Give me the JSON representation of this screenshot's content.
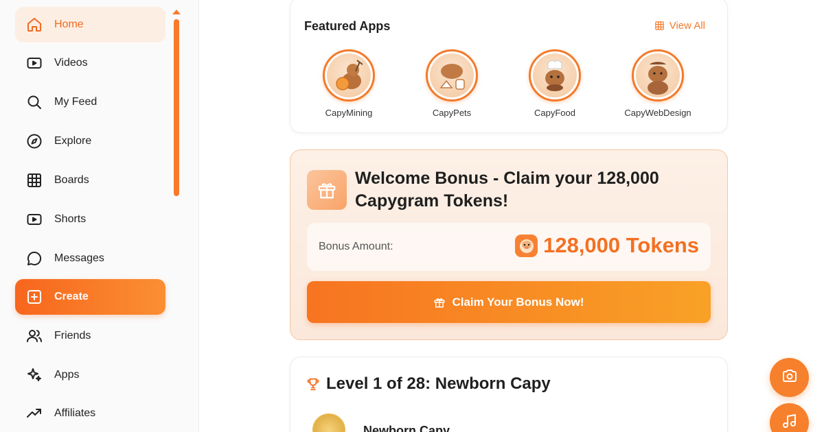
{
  "sidebar": {
    "items": [
      {
        "label": "Home",
        "icon": "home-icon"
      },
      {
        "label": "Videos",
        "icon": "video-icon"
      },
      {
        "label": "My Feed",
        "icon": "search-icon"
      },
      {
        "label": "Explore",
        "icon": "compass-icon"
      },
      {
        "label": "Boards",
        "icon": "grid-icon"
      },
      {
        "label": "Shorts",
        "icon": "video-icon"
      },
      {
        "label": "Messages",
        "icon": "chat-bubble-icon"
      },
      {
        "label": "Create",
        "icon": "plus-square-icon"
      },
      {
        "label": "Friends",
        "icon": "users-icon"
      },
      {
        "label": "Apps",
        "icon": "sparkles-icon"
      },
      {
        "label": "Affiliates",
        "icon": "trending-up-icon"
      }
    ],
    "active": "Home",
    "highlighted": "Create"
  },
  "featured": {
    "title": "Featured Apps",
    "view_all": "View All",
    "apps": [
      {
        "name": "CapyMining"
      },
      {
        "name": "CapyPets"
      },
      {
        "name": "CapyFood"
      },
      {
        "name": "CapyWebDesign"
      }
    ]
  },
  "bonus": {
    "title": "Welcome Bonus - Claim your 128,000 Capygram Tokens!",
    "amount_label": "Bonus Amount:",
    "amount_value": "128,000 Tokens",
    "claim_button": "Claim Your Bonus Now!"
  },
  "level": {
    "title": "Level 1 of 28: Newborn Capy",
    "name": "Newborn Capy"
  },
  "colors": {
    "accent": "#f37022",
    "accent_light": "#fdeee3",
    "text": "#1f1f1f"
  }
}
